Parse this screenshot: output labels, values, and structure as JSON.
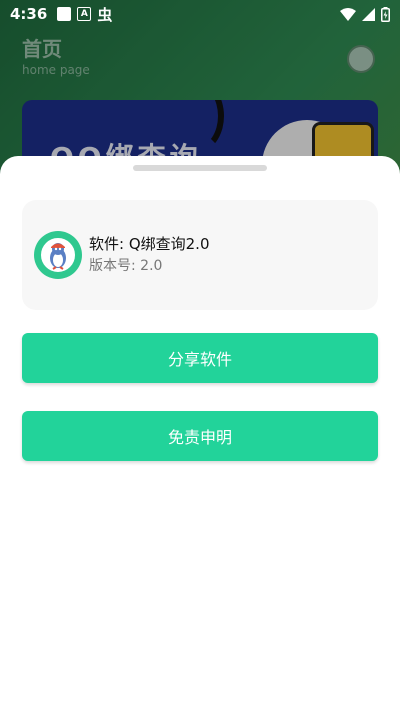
{
  "status_bar": {
    "time": "4:36",
    "notification_a": "A",
    "bug_glyph": "虫"
  },
  "background_page": {
    "title": "首页",
    "subtitle": "home page",
    "banner_text": "QQ绑查询"
  },
  "sheet": {
    "app_name": "软件: Q绑查询2.0",
    "app_version": "版本号: 2.0",
    "share_button": "分享软件",
    "disclaimer_button": "免责申明"
  },
  "colors": {
    "accent_green": "#22d39a",
    "icon_green": "#2fc88f",
    "banner_blue": "#1d2f8a"
  },
  "icons": {
    "status": [
      "square-notification-icon",
      "a-notification-icon",
      "bug-icon",
      "wifi-icon",
      "signal-icon",
      "battery-icon"
    ],
    "header": "avatar-icon",
    "app": "app-logo-icon"
  }
}
